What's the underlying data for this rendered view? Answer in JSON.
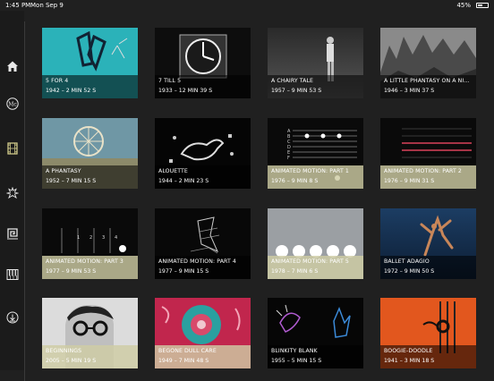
{
  "status": {
    "time": "1:45 PM",
    "date": "Mon Sep 9",
    "battery": "45%",
    "battery_level": 0.45
  },
  "nav": [
    {
      "icon": "home-icon",
      "label": "Home"
    },
    {
      "icon": "mc-logo-icon",
      "label": "McLaren"
    },
    {
      "icon": "film-icon",
      "label": "Films"
    },
    {
      "icon": "figure-icon",
      "label": "Figures"
    },
    {
      "icon": "spiral-icon",
      "label": "Spiral"
    },
    {
      "icon": "piano-icon",
      "label": "Sound"
    },
    {
      "icon": "download-icon",
      "label": "Downloads"
    }
  ],
  "films": [
    {
      "title": "5 FOR 4",
      "meta": "1942 – 2 MIN 52 S",
      "style": "dark"
    },
    {
      "title": "7 TILL 5",
      "meta": "1933 – 12 MIN 39 S",
      "style": "dark"
    },
    {
      "title": "A CHAIRY TALE",
      "meta": "1957 – 9 MIN 53 S",
      "style": "dark"
    },
    {
      "title": "A LITTLE PHANTASY ON A NINETEENTH-CENTURY PAINTING",
      "meta": "1946 – 3 MIN 37 S",
      "style": "dark"
    },
    {
      "title": "A PHANTASY",
      "meta": "1952 – 7 MIN 15 S",
      "style": "dark"
    },
    {
      "title": "ALOUETTE",
      "meta": "1944 – 2 MIN 23 S",
      "style": "dark"
    },
    {
      "title": "ANIMATED MOTION: PART 1",
      "meta": "1976 – 9 MIN 8 S",
      "style": "light"
    },
    {
      "title": "ANIMATED MOTION: PART 2",
      "meta": "1976 – 9 MIN 31 S",
      "style": "light"
    },
    {
      "title": "ANIMATED MOTION: PART 3",
      "meta": "1977 – 9 MIN 53 S",
      "style": "light"
    },
    {
      "title": "ANIMATED MOTION: PART 4",
      "meta": "1977 – 9 MIN 15 S",
      "style": "dark"
    },
    {
      "title": "ANIMATED MOTION: PART 5",
      "meta": "1978 – 7 MIN 6 S",
      "style": "light"
    },
    {
      "title": "BALLET ADAGIO",
      "meta": "1972 – 9 MIN 50 S",
      "style": "dark"
    },
    {
      "title": "BEGINNINGS",
      "meta": "2005 – 5 MIN 19 S",
      "style": "light"
    },
    {
      "title": "BEGONE DULL CARE",
      "meta": "1949 – 7 MIN 48 S",
      "style": "light"
    },
    {
      "title": "BLINKITY BLANK",
      "meta": "1955 – 5 MIN 15 S",
      "style": "dark"
    },
    {
      "title": "BOOGIE-DOODLE",
      "meta": "1941 – 3 MIN 18 S",
      "style": "dark"
    }
  ],
  "staff_labels": [
    "A",
    "B",
    "C",
    "D",
    "E",
    "F"
  ],
  "number_labels": [
    "1",
    "2",
    "3",
    "4"
  ],
  "mc_logo_text": "Mc"
}
